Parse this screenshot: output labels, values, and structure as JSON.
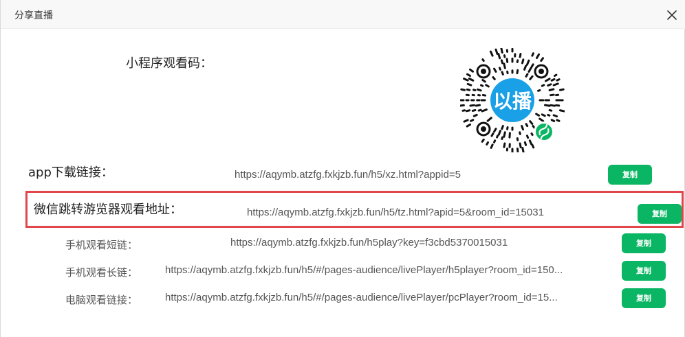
{
  "dialog": {
    "title": "分享直播",
    "close_icon": "close-icon"
  },
  "miniprogram": {
    "label": "小程序观看码：",
    "qr_center_text": "以播",
    "qr_icon": "miniprogram-qr-icon",
    "badge_icon": "miniprogram-link-icon"
  },
  "rows": [
    {
      "label": "app下载链接：",
      "url": "https://aqymb.atzfg.fxkjzb.fun/h5/xz.html?appid=5",
      "button": "复制"
    },
    {
      "label": "微信跳转游览器观看地址：",
      "url": "https://aqymb.atzfg.fxkjzb.fun/h5/tz.html?apid=5&room_id=15031",
      "button": "复制"
    },
    {
      "label": "手机观看短链：",
      "url": "https://aqymb.atzfg.fxkjzb.fun/h5play?key=f3cbd5370015031",
      "button": "复制"
    },
    {
      "label": "手机观看长链：",
      "url": "https://aqymb.atzfg.fxkjzb.fun/h5/#/pages-audience/livePlayer/h5player?room_id=150...",
      "button": "复制"
    },
    {
      "label": "电脑观看链接：",
      "url": "https://aqymb.atzfg.fxkjzb.fun/h5/#/pages-audience/livePlayer/pcPlayer?room_id=15...",
      "button": "复制"
    }
  ],
  "colors": {
    "accent": "#0ab563",
    "highlight": "#e0464a",
    "qr_center": "#1aa0e6"
  }
}
